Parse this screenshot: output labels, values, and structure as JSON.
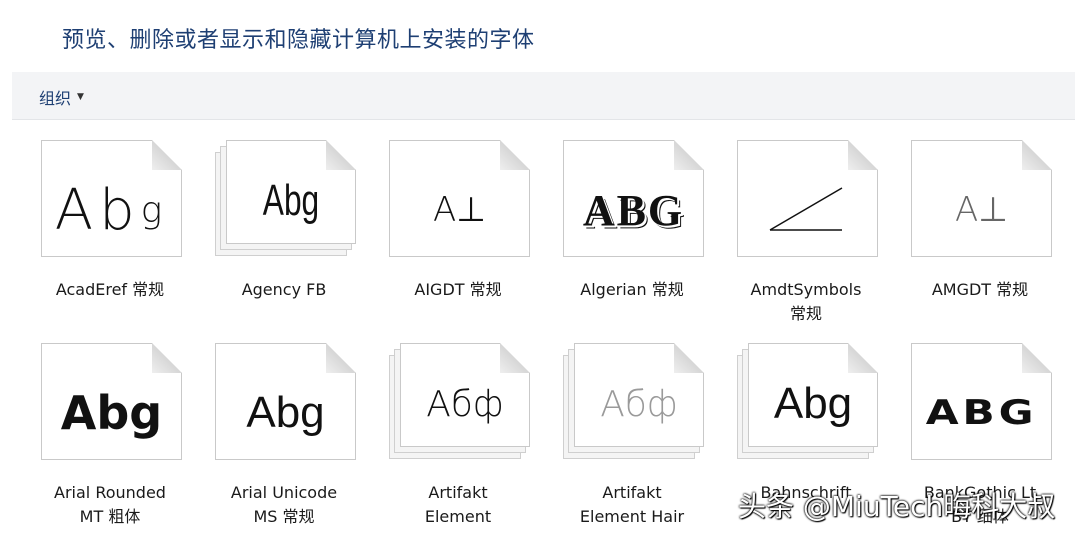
{
  "page": {
    "title": "预览、删除或者显示和隐藏计算机上安装的字体"
  },
  "toolbar": {
    "organize_label": "组织",
    "caret_glyph": "▼"
  },
  "fonts": [
    {
      "label_line1": "AcadEref 常规",
      "label_line2": "",
      "sample": "Ab",
      "sample_extra": "g"
    },
    {
      "label_line1": "Agency FB",
      "label_line2": "",
      "sample": "Abg",
      "sample_extra": ""
    },
    {
      "label_line1": "AIGDT 常规",
      "label_line2": "",
      "sample": "A⊥",
      "sample_extra": ""
    },
    {
      "label_line1": "Algerian 常规",
      "label_line2": "",
      "sample": "ABG",
      "sample_extra": ""
    },
    {
      "label_line1": "AmdtSymbols",
      "label_line2": "常规",
      "sample": "",
      "sample_extra": ""
    },
    {
      "label_line1": "AMGDT 常规",
      "label_line2": "",
      "sample": "A⊥",
      "sample_extra": ""
    },
    {
      "label_line1": "Arial Rounded",
      "label_line2": "MT 粗体",
      "sample": "Abg",
      "sample_extra": ""
    },
    {
      "label_line1": "Arial Unicode",
      "label_line2": "MS 常规",
      "sample": "Abg",
      "sample_extra": ""
    },
    {
      "label_line1": "Artifakt",
      "label_line2": "Element",
      "sample": "Абф",
      "sample_extra": ""
    },
    {
      "label_line1": "Artifakt",
      "label_line2": "Element Hair",
      "sample": "Абф",
      "sample_extra": ""
    },
    {
      "label_line1": "Bahnschrift",
      "label_line2": "",
      "sample": "Abg",
      "sample_extra": ""
    },
    {
      "label_line1": "BankGothic Lt",
      "label_line2": "BT 细体",
      "sample": "ABG",
      "sample_extra": ""
    }
  ],
  "watermark": {
    "text": "头条 @MiuTech晦科大叔"
  },
  "colors": {
    "title": "#1e3f73",
    "toolbar_bg": "#f3f4f6"
  }
}
